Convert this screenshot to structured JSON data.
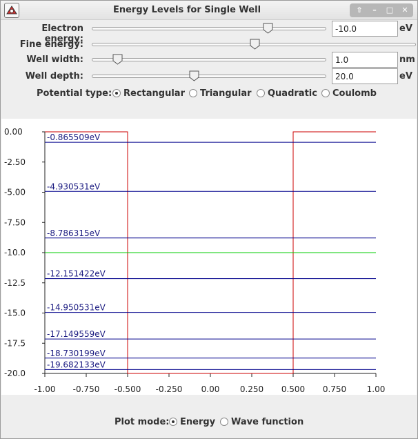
{
  "window": {
    "title": "Energy Levels for Single Well",
    "controls": {
      "up": "⇧",
      "minimize": "–",
      "maximize": "□",
      "close": "✕"
    }
  },
  "controls": {
    "electron_energy": {
      "label": "Electron energy:",
      "value": "-10.0",
      "unit": "eV",
      "slider_fraction": 0.76
    },
    "fine_energy": {
      "label": "Fine energy:",
      "slider_fraction": 0.5
    },
    "well_width": {
      "label": "Well width:",
      "value": "1.0",
      "unit": "nm",
      "slider_fraction": 0.09
    },
    "well_depth": {
      "label": "Well depth:",
      "value": "20.0",
      "unit": "eV",
      "slider_fraction": 0.43
    }
  },
  "potential_type": {
    "label": "Potential type:",
    "options": [
      "Rectangular",
      "Triangular",
      "Quadratic",
      "Coulomb"
    ],
    "selected": "Rectangular"
  },
  "plot_mode": {
    "label": "Plot mode:",
    "options": [
      "Energy",
      "Wave function"
    ],
    "selected": "Energy"
  },
  "colors": {
    "potential": "#cc0000",
    "level": "#00008b",
    "electron": "#00cc00",
    "label_text": "#1a1a80"
  },
  "chart_data": {
    "type": "line",
    "xlim": [
      -1.0,
      1.0
    ],
    "ylim": [
      -20.0,
      0.0
    ],
    "x_ticks": [
      "-1.00",
      "-0.750",
      "-0.500",
      "-0.250",
      "0.00",
      "0.250",
      "0.500",
      "0.750",
      "1.00"
    ],
    "x_tick_values": [
      -1.0,
      -0.75,
      -0.5,
      -0.25,
      0.0,
      0.25,
      0.5,
      0.75,
      1.0
    ],
    "y_ticks": [
      "0.00",
      "-2.50",
      "-5.00",
      "-7.50",
      "-10.0",
      "-12.5",
      "-15.0",
      "-17.5",
      "-20.0"
    ],
    "y_tick_values": [
      0,
      -2.5,
      -5.0,
      -7.5,
      -10.0,
      -12.5,
      -15.0,
      -17.5,
      -20.0
    ],
    "well": {
      "left_edge": -0.5,
      "right_edge": 0.5,
      "outside_potential": 0.0,
      "inside_potential": -20.0
    },
    "electron_energy": -10.0,
    "levels": [
      {
        "energy": -0.865509,
        "label": "-0.865509eV"
      },
      {
        "energy": -4.930531,
        "label": "-4.930531eV"
      },
      {
        "energy": -8.786315,
        "label": "-8.786315eV"
      },
      {
        "energy": -12.151422,
        "label": "-12.151422eV"
      },
      {
        "energy": -14.950531,
        "label": "-14.950531eV"
      },
      {
        "energy": -17.149559,
        "label": "-17.149559eV"
      },
      {
        "energy": -18.730199,
        "label": "-18.730199eV"
      },
      {
        "energy": -19.682133,
        "label": "-19.682133eV"
      }
    ]
  }
}
